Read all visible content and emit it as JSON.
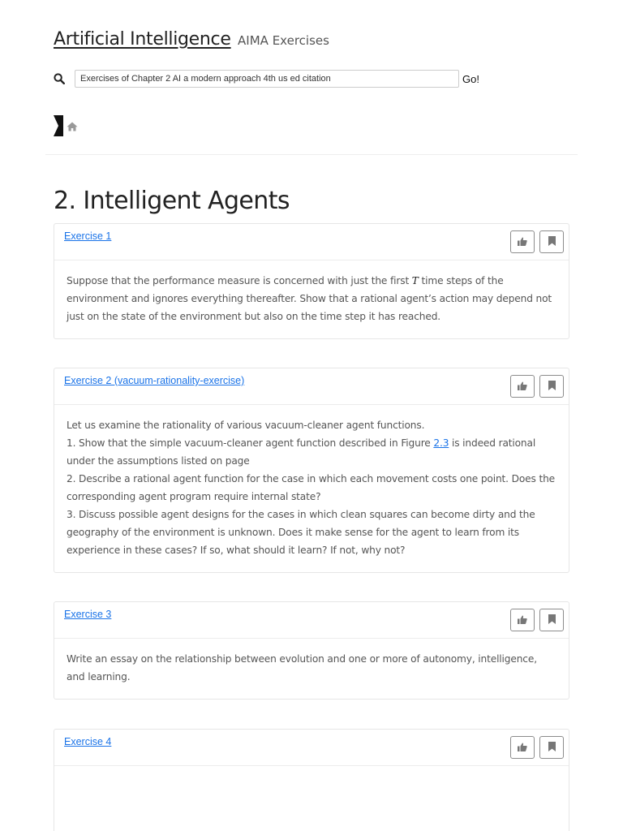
{
  "header": {
    "title": "Artificial Intelligence",
    "subtitle": "AIMA Exercises"
  },
  "search": {
    "value": "Exercises of Chapter 2 AI a modern approach 4th us ed citation",
    "go_label": "Go!"
  },
  "chapter": {
    "title": "2. Intelligent Agents"
  },
  "icons": {
    "search": "search-icon",
    "sidebar_toggle": "sidebar-toggle-icon",
    "home": "home-icon",
    "like": "thumbs-up-icon",
    "bookmark": "bookmark-icon"
  },
  "colors": {
    "link": "#1a73e8",
    "text": "#555555",
    "heading": "#222222"
  },
  "exercises": [
    {
      "link": "Exercise 1",
      "body": {
        "before": "Suppose that the performance measure is concerned with just the first ",
        "math": "T",
        "after": " time steps of the environment and ignores everything thereafter. Show that a rational agent’s action may depend not just on the state of the environment but also on the time step it has reached."
      }
    },
    {
      "link": "Exercise 2 (vacuum-rationality-exercise)",
      "body": {
        "intro": "Let us examine the rationality of various vacuum-cleaner agent functions.",
        "item1_before": "1. Show that the simple vacuum-cleaner agent function described in Figure ",
        "item1_link": "2.3",
        "item1_after": " is indeed rational under the assumptions listed on page",
        "item2": "2. Describe a rational agent function for the case in which each movement costs one point. Does the corresponding agent program require internal state?",
        "item3": "3. Discuss possible agent designs for the cases in which clean squares can become dirty and the geography of the environment is unknown. Does it make sense for the agent to learn from its experience in these cases? If so, what should it learn? If not, why not?"
      }
    },
    {
      "link": "Exercise 3",
      "body": {
        "text": "Write an essay on the relationship between evolution and one or more of autonomy, intelligence, and learning."
      }
    },
    {
      "link": "Exercise 4",
      "body": {}
    }
  ]
}
